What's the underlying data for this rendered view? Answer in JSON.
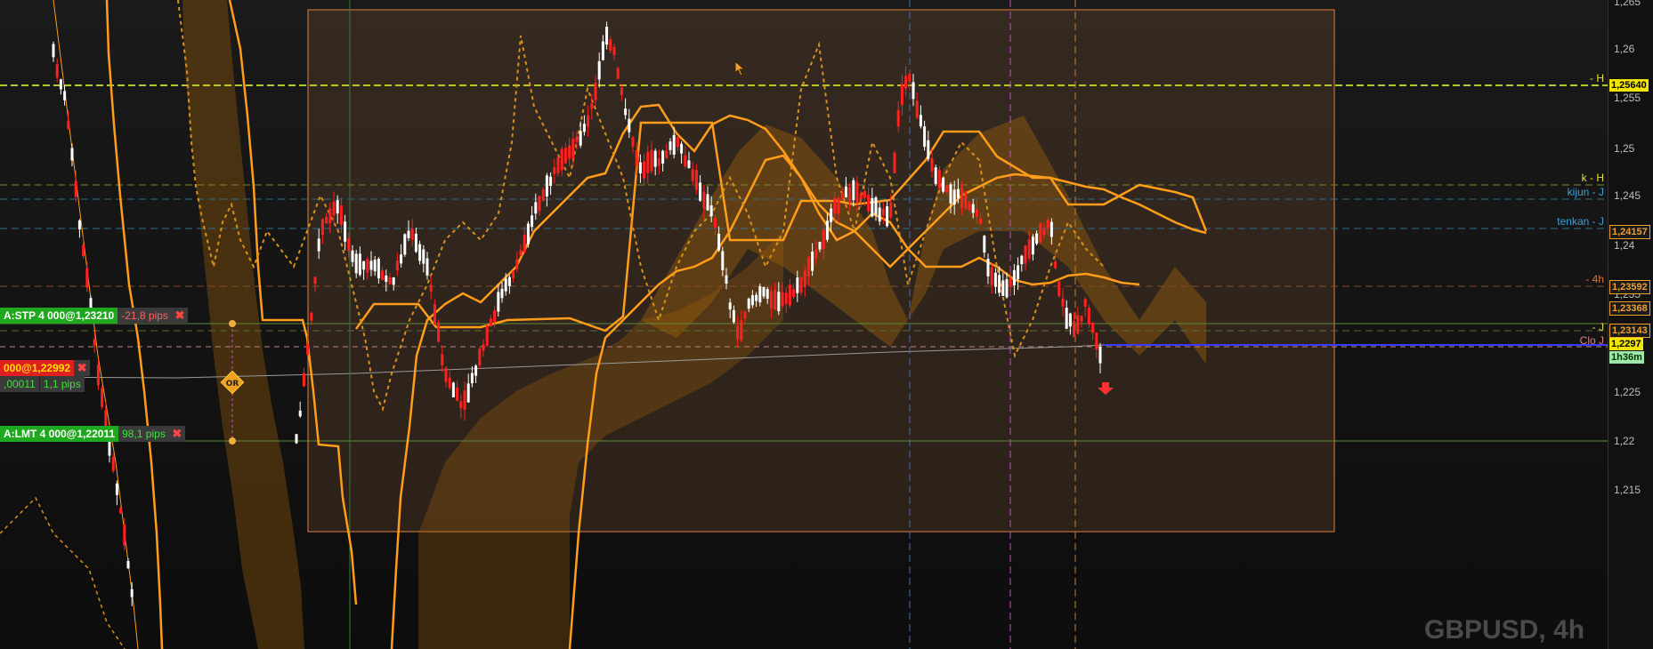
{
  "symbol_label": "GBPUSD, 4h",
  "price_axis": {
    "ticks": [
      "1,265",
      "1,26",
      "1,255",
      "1,25",
      "1,245",
      "1,24",
      "1,235",
      "1,225",
      "1,22",
      "1,215"
    ]
  },
  "price_boxes": [
    {
      "id": "high",
      "text": "1,25640",
      "bg": "#f2e600",
      "fg": "#000000"
    },
    {
      "id": "tenkan",
      "text": "1,24157",
      "bg": "#1a1a1a",
      "fg": "#f0a030"
    },
    {
      "id": "4h",
      "text": "1,23592",
      "bg": "#1a1a1a",
      "fg": "#f0a030"
    },
    {
      "id": "kijun",
      "text": "1,23368",
      "bg": "#1a1a1a",
      "fg": "#f0a030"
    },
    {
      "id": "j",
      "text": "1,23143",
      "bg": "#1a1a1a",
      "fg": "#f0a030"
    },
    {
      "id": "last",
      "text": "1,2297",
      "bg": "#f2e600",
      "fg": "#000000"
    },
    {
      "id": "timer",
      "text": "1h36m",
      "bg": "#9de8a8",
      "fg": "#003300"
    }
  ],
  "line_labels": {
    "h": "- H",
    "k_h": "k - H",
    "kijun_j": "kijun - J",
    "tenkan_j": "tenkan - J",
    "four_h": "- 4h",
    "j": "- J",
    "clo_j": "Clo J"
  },
  "orders": {
    "stop": {
      "label": "A:STP 4 000@1,23210",
      "pips": "-21,8 pips"
    },
    "position": {
      "label": "000@1,22992",
      "pnl": ",00011",
      "pips": "1,1 pips"
    },
    "limit": {
      "label": "A:LMT 4 000@1,22011",
      "pips": "98,1 pips"
    }
  },
  "marker": {
    "text": "OR"
  },
  "close_symbol": "✖",
  "colors": {
    "bull": "#ffffff",
    "bear": "#ff2020",
    "ichimoku": "#ff9d1a",
    "high_line": "#b6cc1a",
    "kijun_line": "#3aa0d8"
  }
}
